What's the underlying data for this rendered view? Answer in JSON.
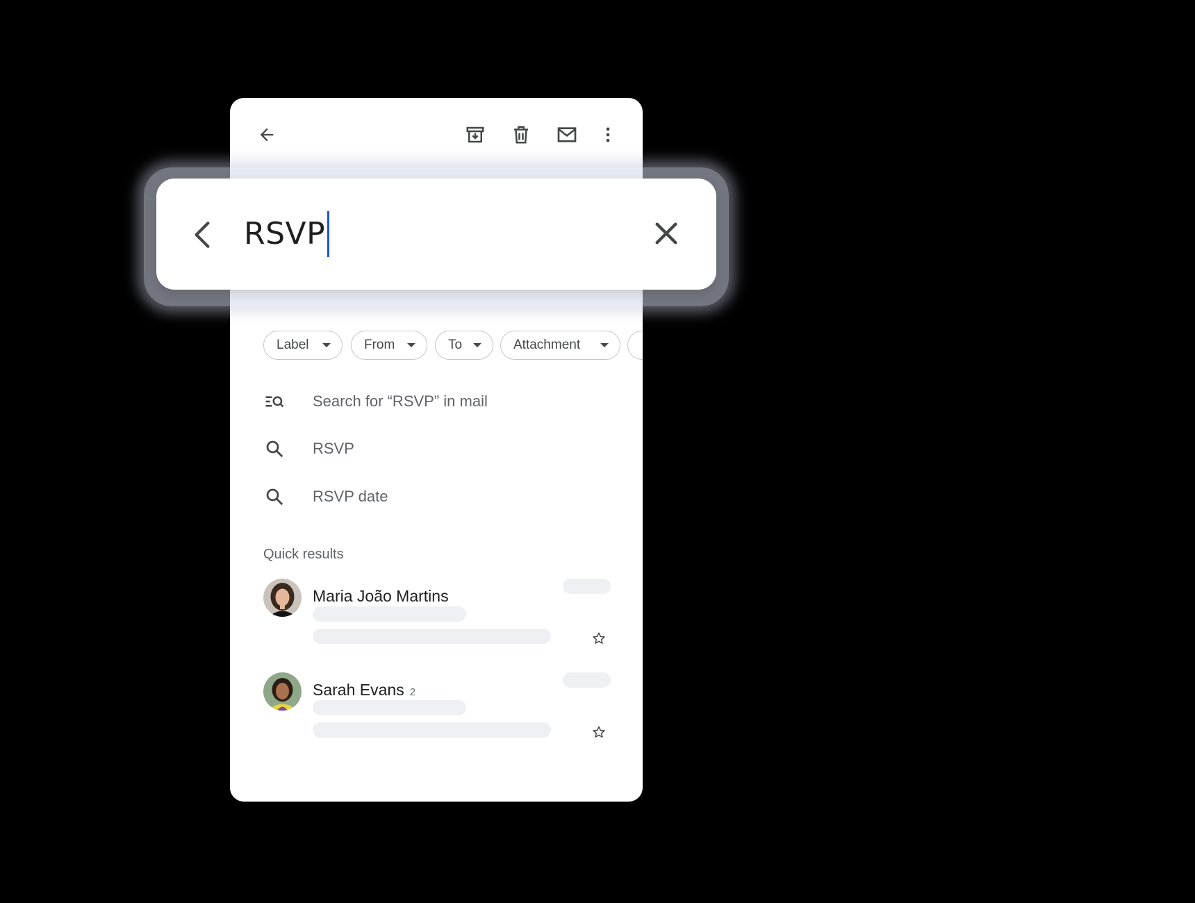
{
  "toolbar": {
    "back_icon": "arrow-left-icon",
    "archive_icon": "archive-icon",
    "delete_icon": "trash-icon",
    "mark_unread_icon": "mail-icon",
    "more_icon": "more-vert-icon"
  },
  "search": {
    "query": "RSVP",
    "back_icon": "chevron-left-icon",
    "clear_icon": "close-icon"
  },
  "chips": [
    {
      "label": "Label"
    },
    {
      "label": "From"
    },
    {
      "label": "To"
    },
    {
      "label": "Attachment"
    }
  ],
  "suggestions": [
    {
      "icon": "search-in-mail-icon",
      "text": "Search for “RSVP” in mail"
    },
    {
      "icon": "search-icon",
      "text": "RSVP"
    },
    {
      "icon": "search-icon",
      "text": "RSVP date"
    }
  ],
  "quick_results": {
    "title": "Quick results",
    "items": [
      {
        "sender": "Maria João Martins",
        "count": "",
        "starred": false
      },
      {
        "sender": "Sarah Evans",
        "count": "2",
        "starred": false
      }
    ]
  },
  "colors": {
    "caret": "#1a57d6",
    "text_primary": "#1f1f1f",
    "text_secondary": "#5f6368",
    "skeleton": "#eef0f3"
  }
}
